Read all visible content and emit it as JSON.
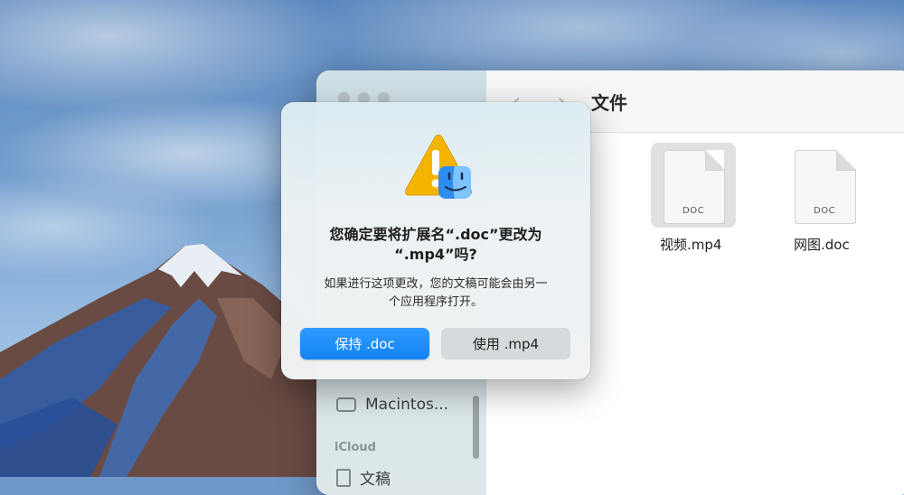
{
  "finder": {
    "title": "文件",
    "nav_back": "‹",
    "nav_forward": "›",
    "sidebar": {
      "items": [
        {
          "label": "Macintos...",
          "icon": "drive-icon"
        }
      ],
      "sections": [
        {
          "label": "iCloud"
        }
      ],
      "partial_item": {
        "label": "文稿",
        "icon": "document-icon"
      }
    },
    "files": [
      {
        "name": "视频.mp4",
        "type_label": "DOC",
        "selected": true
      },
      {
        "name": "网图.doc",
        "type_label": "DOC",
        "selected": false
      }
    ]
  },
  "dialog": {
    "title_line1": "您确定要将扩展名“.doc”更改为",
    "title_line2": "“.mp4”吗?",
    "message_line1": "如果进行这项更改，您的文稿可能会由另一",
    "message_line2": "个应用程序打开。",
    "keep_button": "保持 .doc",
    "use_button": "使用 .mp4",
    "icon": "warning-triangle-finder-icon"
  },
  "colors": {
    "primary_button": "#1a8cff",
    "warning": "#f5b400",
    "finder_blue": "#2d8cf0"
  }
}
